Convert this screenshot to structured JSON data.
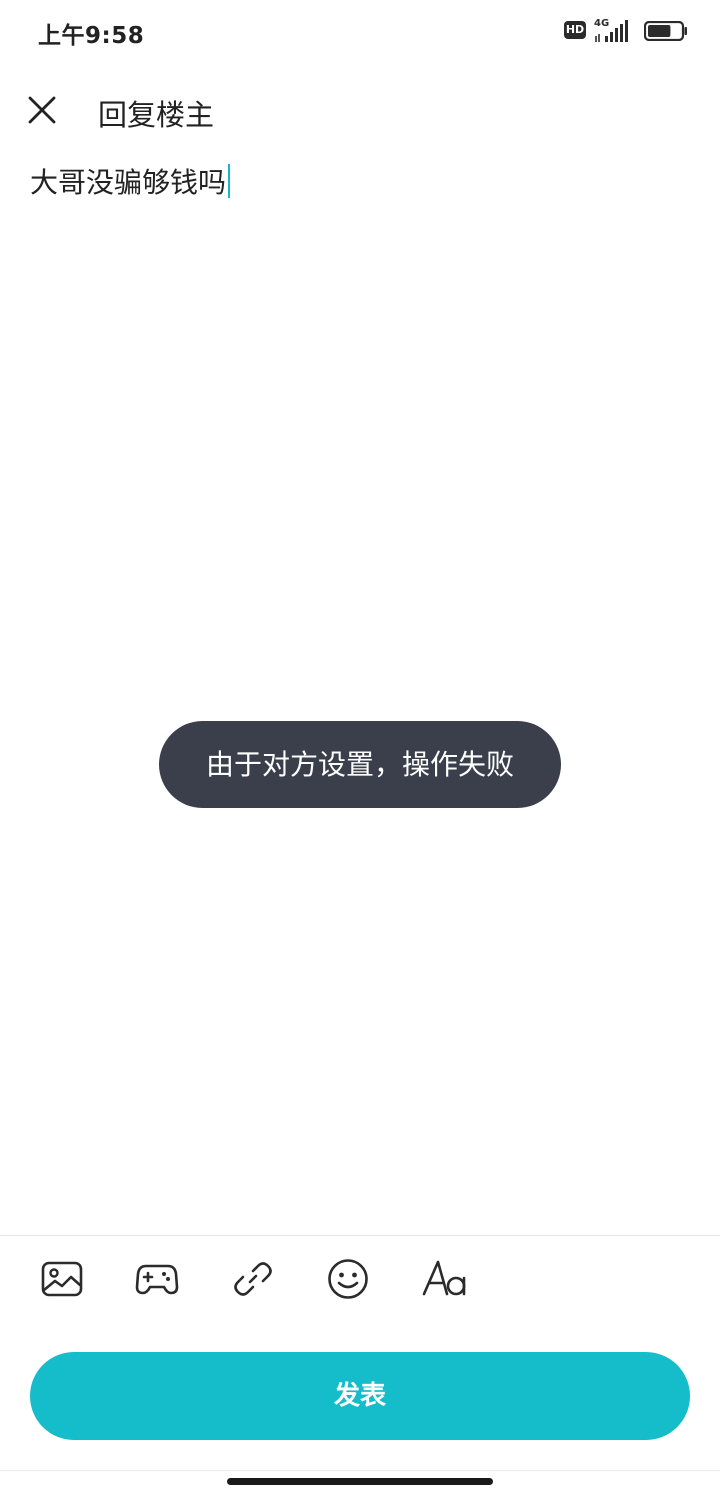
{
  "status_bar": {
    "time": "上午9:58",
    "hd_label": "HD",
    "network": "4G",
    "battery_level": 0.7
  },
  "header": {
    "close_icon": "close-icon",
    "title": "回复楼主"
  },
  "editor": {
    "content": "大哥没骗够钱吗"
  },
  "toast": {
    "message": "由于对方设置，操作失败"
  },
  "toolbar": {
    "icons": [
      "image-icon",
      "gamepad-icon",
      "link-icon",
      "emoji-icon",
      "text-format-icon"
    ]
  },
  "publish": {
    "label": "发表"
  },
  "colors": {
    "accent": "#15bcca",
    "toast_bg": "#3a3f4b",
    "text": "#222222"
  }
}
